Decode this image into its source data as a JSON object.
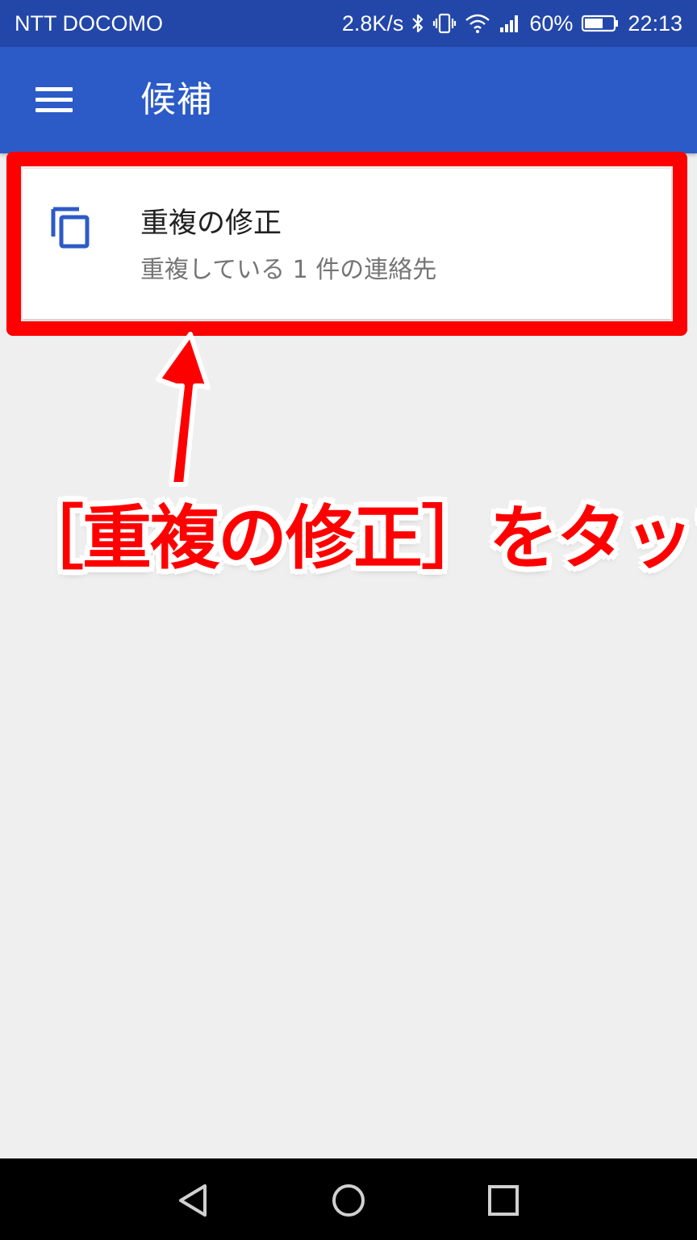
{
  "status_bar": {
    "carrier": "NTT DOCOMO",
    "network_speed": "2.8K/s",
    "battery_percent": "60%",
    "time": "22:13",
    "icons": [
      "bluetooth-icon",
      "vibrate-icon",
      "wifi-icon",
      "signal-icon",
      "battery-icon"
    ]
  },
  "app_bar": {
    "title": "候補",
    "menu_icon": "menu-icon"
  },
  "card": {
    "title": "重複の修正",
    "subtitle": "重複している 1 件の連絡先",
    "icon": "copy-icon"
  },
  "annotation": {
    "text": "［重複の修正］をタップ",
    "color": "#ff0000"
  },
  "nav_bar": {
    "icons": [
      "back-icon",
      "home-icon",
      "recent-apps-icon"
    ]
  },
  "colors": {
    "status_bar": "#2347a8",
    "app_bar": "#2c5bc7",
    "background": "#efefef",
    "accent_icon": "#2c5bc7",
    "annotation": "#ff0000"
  }
}
